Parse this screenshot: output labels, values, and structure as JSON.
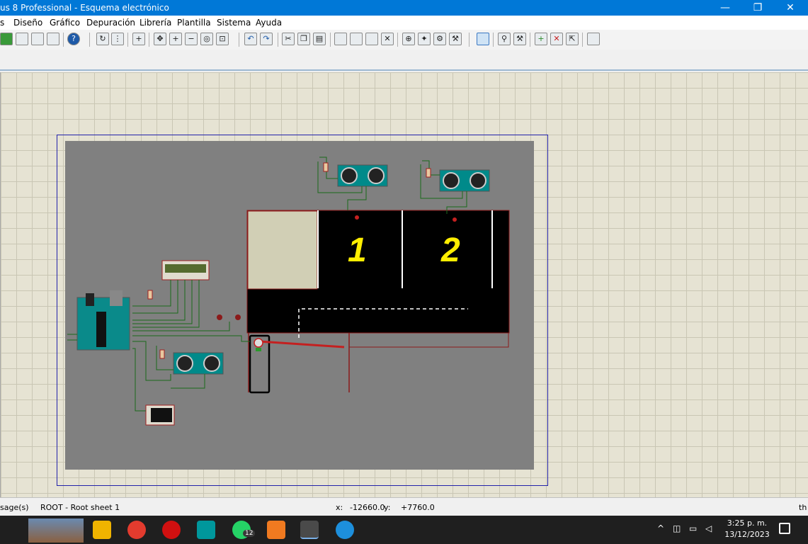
{
  "window": {
    "title": "us 8 Professional - Esquema electrónico",
    "minimize": "—",
    "maximize": "❐",
    "close": "✕"
  },
  "menu": [
    "s",
    "Diseño",
    "Gráfico",
    "Depuración",
    "Librería",
    "Plantilla",
    "Sistema",
    "Ayuda"
  ],
  "schematic": {
    "bay_1_label": "1",
    "bay_2_label": "2"
  },
  "status": {
    "messages": "sage(s)",
    "sheet": "ROOT - Root sheet 1",
    "x_label": "x:",
    "x_value": "-12660.0",
    "y_label": "y:",
    "y_value": "+7760.0",
    "right_text": "th"
  },
  "taskbar": {
    "badge_count": "12",
    "time": "3:25 p. m.",
    "date": "13/12/2023"
  }
}
